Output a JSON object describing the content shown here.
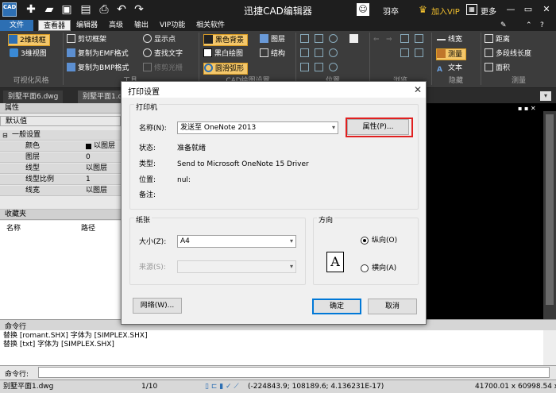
{
  "titlebar": {
    "app_logo": "CAD",
    "title": "迅捷CAD编辑器",
    "user_name": "羽卒",
    "vip_label": "加入VIP",
    "more_label": "更多",
    "quick_icons": [
      "plus-icon",
      "folder-icon",
      "save-icon",
      "save-as-icon",
      "print-icon",
      "undo-icon",
      "redo-icon"
    ]
  },
  "menubar": {
    "items": [
      "文件",
      "查看器",
      "编辑器",
      "高级",
      "输出",
      "VIP功能",
      "相关软件"
    ]
  },
  "ribbon": {
    "visual_style": {
      "btn_2d": "2维线框",
      "btn_3d": "3维视图",
      "label": "可视化风格"
    },
    "tools": {
      "items": [
        "剪切框架",
        "复制为EMF格式",
        "复制为BMP格式",
        "显示点",
        "查找文字",
        "修剪光栅"
      ],
      "label": "工具"
    },
    "cad_settings": {
      "items": [
        "黑色背景",
        "黑白绘图",
        "圆滑弧形",
        "图层",
        "结构"
      ],
      "label": "CAD绘图设置"
    },
    "position_label": "位置",
    "browse_label": "浏览",
    "hide": {
      "items": [
        "线宽",
        "测量",
        "文本"
      ],
      "label": "隐藏"
    },
    "measure": {
      "items": [
        "距离",
        "多段线长度",
        "面积"
      ],
      "label": "测量"
    }
  },
  "doctabs": [
    "别墅平面6.dwg",
    "别墅平面1.dwg"
  ],
  "leftpanel": {
    "properties_title": "属性",
    "default_label": "默认值",
    "group_general": "一般设置",
    "rows": [
      {
        "k": "颜色",
        "v": "以图层"
      },
      {
        "k": "图层",
        "v": "0"
      },
      {
        "k": "线型",
        "v": "以图层"
      },
      {
        "k": "线型比例",
        "v": "1"
      },
      {
        "k": "线宽",
        "v": "以图层"
      }
    ],
    "favorites_title": "收藏夹",
    "col_name": "名称",
    "col_path": "路径"
  },
  "command": {
    "header": "命令行",
    "lines": [
      "替换 [romant.SHX] 字体为 [SIMPLEX.SHX]",
      "替换 [txt] 字体为 [SIMPLEX.SHX]"
    ],
    "input_label": "命令行:"
  },
  "statusbar": {
    "file": "别墅平面1.dwg",
    "page": "1/10",
    "coords": "(-224843.9; 108189.6; 4.136231E-17)",
    "dims": "41700.01 x 60998.54 x 0"
  },
  "dialog": {
    "title": "打印设置",
    "printer_group": "打印机",
    "name_label": "名称(N):",
    "name_value": "发送至 OneNote 2013",
    "properties_button": "属性(P)...",
    "status_label": "状态:",
    "status_value": "准备就绪",
    "type_label": "类型:",
    "type_value": "Send to Microsoft OneNote 15 Driver",
    "where_label": "位置:",
    "where_value": "nul:",
    "comment_label": "备注:",
    "paper_group": "纸张",
    "size_label": "大小(Z):",
    "size_value": "A4",
    "source_label": "来源(S):",
    "orientation_group": "方向",
    "portrait_label": "纵向(O)",
    "landscape_label": "横向(A)",
    "orientation_selected": "portrait",
    "network_button": "网络(W)...",
    "ok_button": "确定",
    "cancel_button": "取消"
  }
}
